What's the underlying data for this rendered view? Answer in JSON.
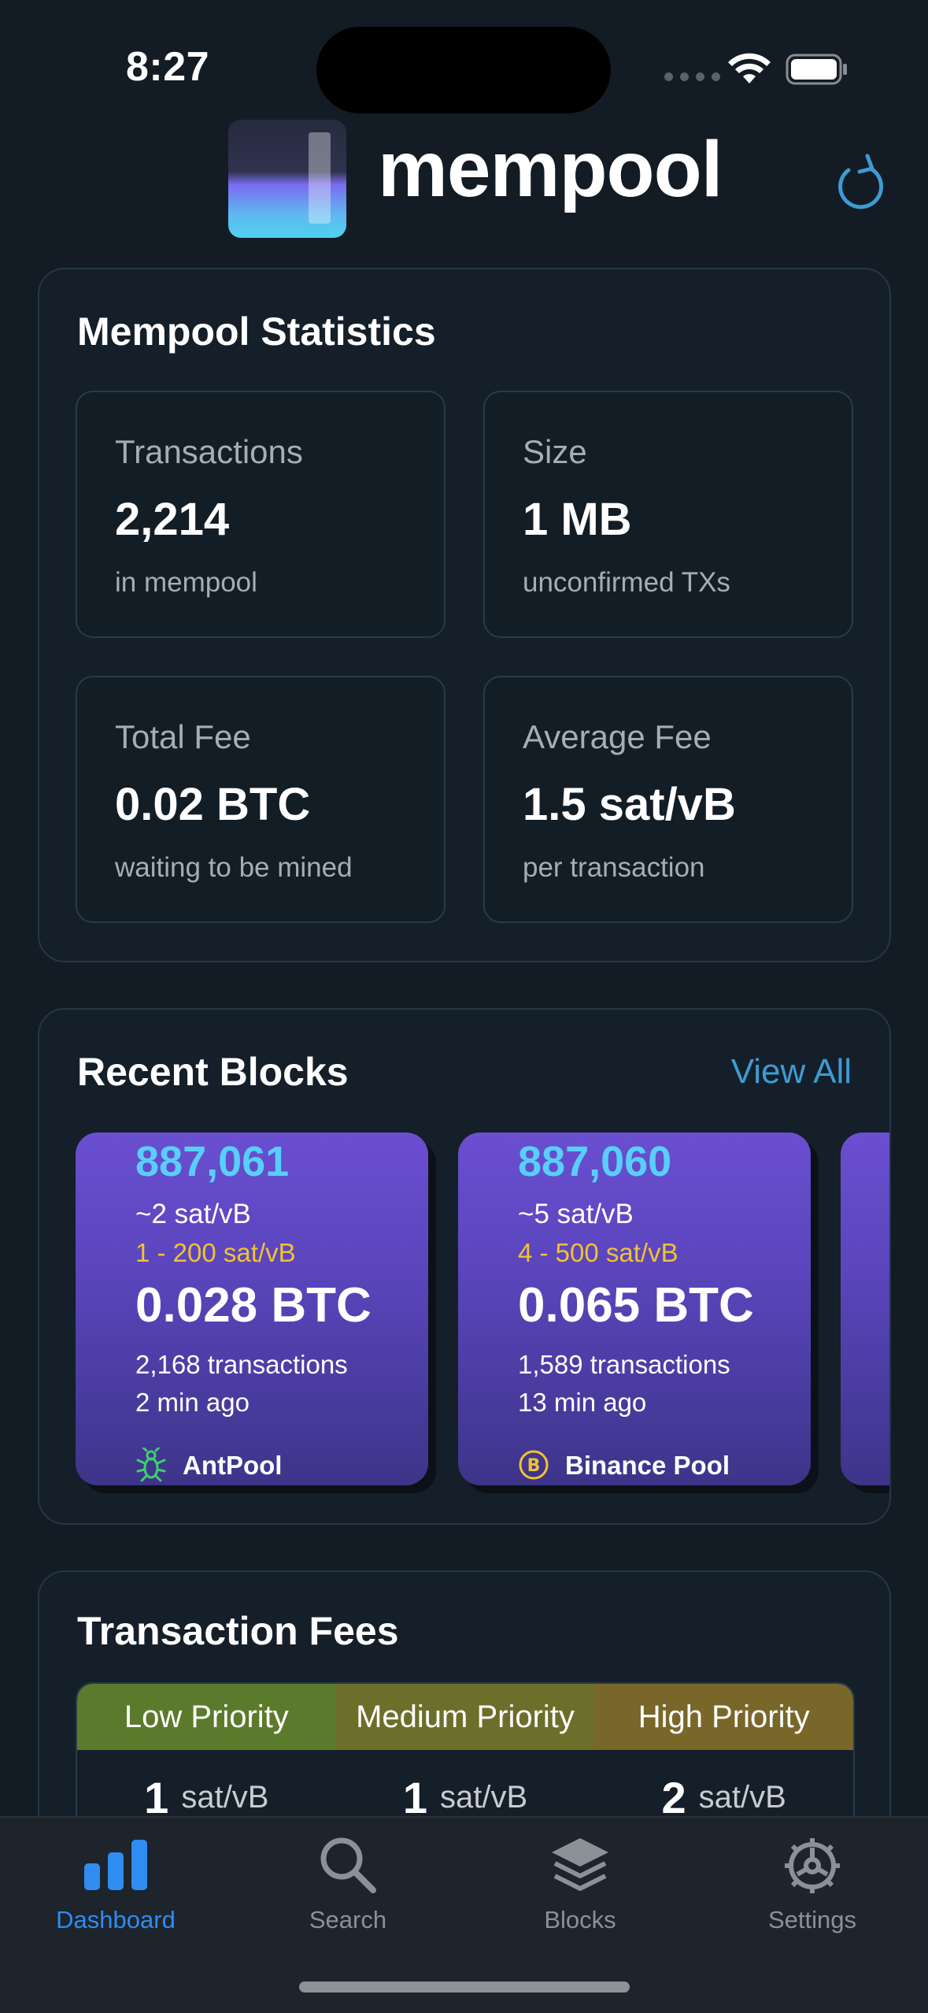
{
  "status_bar": {
    "time": "8:27"
  },
  "header": {
    "brand": "mempool"
  },
  "stats": {
    "title": "Mempool Statistics",
    "items": [
      {
        "label": "Transactions",
        "value": "2,214",
        "sub": "in mempool"
      },
      {
        "label": "Size",
        "value": "1 MB",
        "sub": "unconfirmed TXs"
      },
      {
        "label": "Total Fee",
        "value": "0.02 BTC",
        "sub": "waiting to be mined"
      },
      {
        "label": "Average Fee",
        "value": "1.5 sat/vB",
        "sub": "per transaction"
      }
    ]
  },
  "blocks": {
    "title": "Recent Blocks",
    "view_all": "View All",
    "items": [
      {
        "height": "887,061",
        "median_fee": "~2 sat/vB",
        "fee_range": "1 - 200 sat/vB",
        "total": "0.028 BTC",
        "txs": "2,168 transactions",
        "ago": "2 min ago",
        "pool": "AntPool",
        "pool_icon": "ant-icon"
      },
      {
        "height": "887,060",
        "median_fee": "~5 sat/vB",
        "fee_range": "4 - 500 sat/vB",
        "total": "0.065 BTC",
        "txs": "1,589 transactions",
        "ago": "13 min ago",
        "pool": "Binance Pool",
        "pool_icon": "binance-icon"
      }
    ]
  },
  "fees": {
    "title": "Transaction Fees",
    "columns": [
      {
        "label": "Low Priority",
        "value": "1",
        "unit": "sat/vB",
        "color": "#5c7a2b"
      },
      {
        "label": "Medium Priority",
        "value": "1",
        "unit": "sat/vB",
        "color": "#6c6f2a"
      },
      {
        "label": "High Priority",
        "value": "2",
        "unit": "sat/vB",
        "color": "#79672a"
      }
    ]
  },
  "tabs": [
    {
      "label": "Dashboard",
      "icon": "chart-bars-icon",
      "active": true
    },
    {
      "label": "Search",
      "icon": "magnifier-icon",
      "active": false
    },
    {
      "label": "Blocks",
      "icon": "layers-icon",
      "active": false
    },
    {
      "label": "Settings",
      "icon": "gear-icon",
      "active": false
    }
  ],
  "colors": {
    "accent": "#2f8cf0",
    "link": "#3e9bd3",
    "block_height": "#58cffb",
    "fee_range": "#f1c232"
  }
}
